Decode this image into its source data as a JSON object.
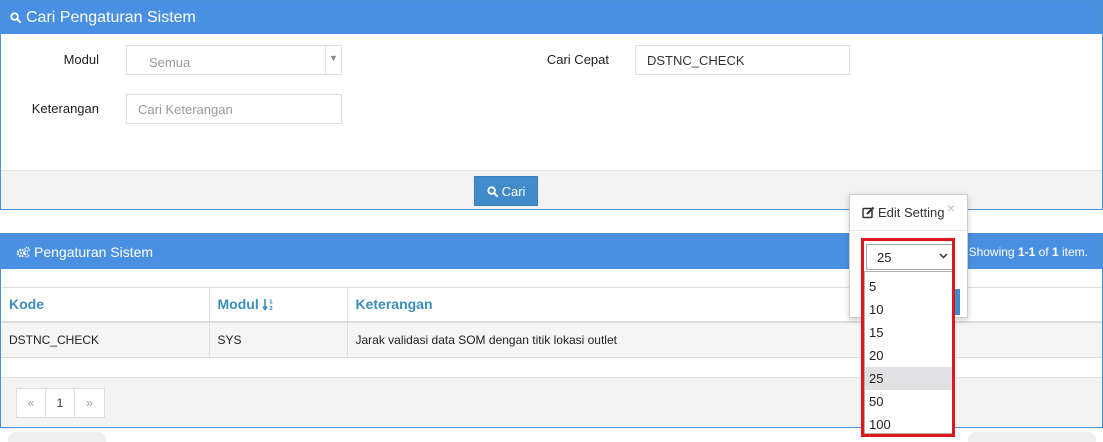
{
  "search_panel": {
    "title": "Cari Pengaturan Sistem",
    "modul_label": "Modul",
    "modul_value": "Semua",
    "keterangan_label": "Keterangan",
    "keterangan_placeholder": "Cari Keterangan",
    "cari_cepat_label": "Cari Cepat",
    "cari_cepat_value": "DSTNC_CHECK",
    "search_button": "Cari"
  },
  "result_panel": {
    "title": "Pengaturan Sistem",
    "summary_prefix": "Showing ",
    "summary_range": "1-1",
    "summary_of": " of ",
    "summary_total": "1",
    "summary_suffix": " item.",
    "columns": [
      "Kode",
      "Modul",
      "Keterangan"
    ],
    "rows": [
      {
        "kode": "DSTNC_CHECK",
        "modul": "SYS",
        "keterangan": "Jarak validasi data SOM dengan titik lokasi outlet"
      }
    ],
    "pagination": {
      "prev": "«",
      "current": "1",
      "next": "»"
    }
  },
  "popover": {
    "title": "Edit Setting",
    "close": "×",
    "page_size_selected": "25",
    "page_size_options": [
      "5",
      "10",
      "15",
      "20",
      "25",
      "50",
      "100"
    ]
  },
  "colors": {
    "header_blue": "#4a90e2",
    "button_blue": "#428bca",
    "link_blue": "#3c8dbc",
    "highlight_red": "#e0181e"
  }
}
